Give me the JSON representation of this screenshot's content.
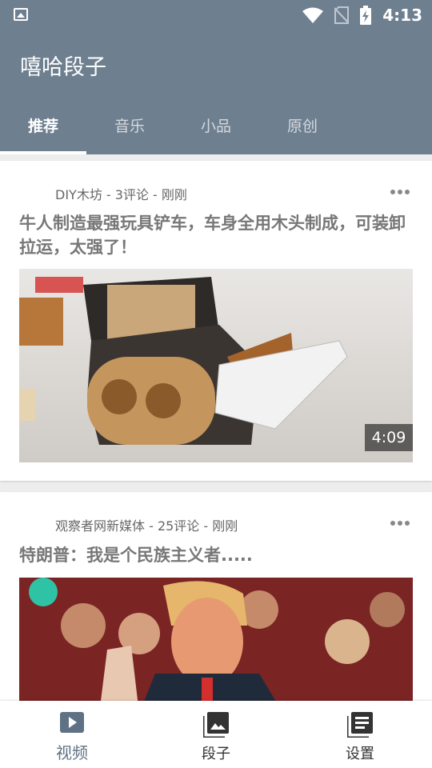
{
  "status_bar": {
    "time": "4:13"
  },
  "app": {
    "title": "嘻哈段子"
  },
  "tabs": [
    {
      "label": "推荐"
    },
    {
      "label": "音乐"
    },
    {
      "label": "小品"
    },
    {
      "label": "原创"
    }
  ],
  "feed": [
    {
      "meta": "DIY木坊 - 3评论 - 刚刚",
      "title": "牛人制造最强玩具铲车，车身全用木头制成，可装卸拉运，太强了！",
      "duration": "4:09"
    },
    {
      "meta": "观察者网新媒体 - 25评论 - 刚刚",
      "title": "特朗普：我是个民族主义者....."
    }
  ],
  "bottom_nav": [
    {
      "label": "视频",
      "icon": "play-icon"
    },
    {
      "label": "段子",
      "icon": "image-icon"
    },
    {
      "label": "设置",
      "icon": "list-icon"
    }
  ],
  "colors": {
    "primary": "#6e7f90",
    "nav_active": "#5f7185"
  }
}
